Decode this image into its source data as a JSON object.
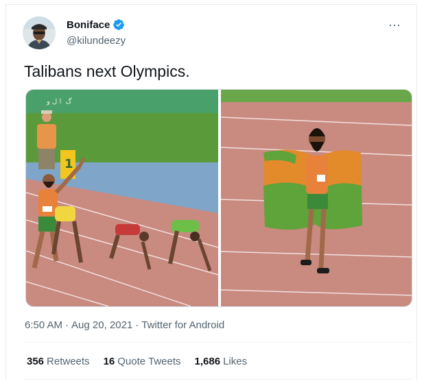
{
  "author": {
    "display_name": "Boniface",
    "handle": "@kilundeezy",
    "verified": true
  },
  "more_icon": "⋯",
  "tweet": {
    "text": "Talibans next Olympics."
  },
  "meta": {
    "time": "6:50 AM",
    "date": "Aug 20, 2021",
    "source": "Twitter for Android",
    "sep": "·"
  },
  "stats": {
    "retweets_count": "356",
    "retweets_label": "Retweets",
    "quotes_count": "16",
    "quotes_label": "Quote Tweets",
    "likes_count": "1,686",
    "likes_label": "Likes"
  },
  "colors": {
    "verified_blue": "#1d9bf0",
    "track": "#c98a80",
    "grass": "#5a9a3a",
    "flag_orange": "#e38a2b",
    "flag_green": "#5fa33b"
  }
}
